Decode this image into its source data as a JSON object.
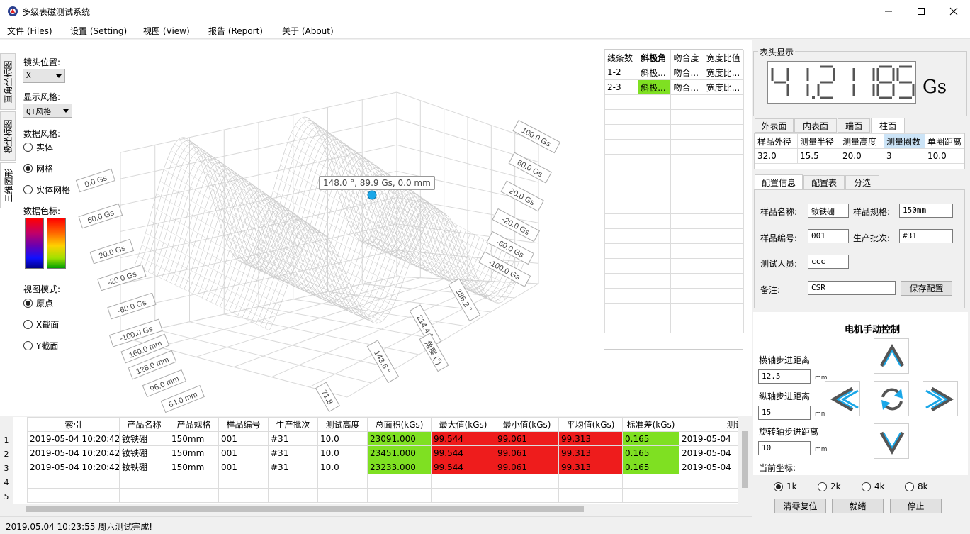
{
  "window": {
    "title": "多级表磁测试系统"
  },
  "menu": [
    {
      "label": "文件 (Files)"
    },
    {
      "label": "设置 (Setting)"
    },
    {
      "label": "视图 (View)"
    },
    {
      "label": "报告 (Report)"
    },
    {
      "label": "关于 (About)"
    }
  ],
  "vertical_tabs": [
    "直角坐标图",
    "极坐标图",
    "三维图形"
  ],
  "left_controls": {
    "lens_position_label": "镜头位置:",
    "lens_position_value": "X",
    "display_style_label": "显示风格:",
    "display_style_value": "QT风格",
    "data_style_label": "数据风格:",
    "data_style_options": [
      "实体",
      "网格",
      "实体网格"
    ],
    "data_style_selected": "网格",
    "colormap_label": "数据色标:",
    "view_mode_label": "视图模式:",
    "view_mode_options": [
      "原点",
      "X截面",
      "Y截面"
    ],
    "view_mode_selected": "原点"
  },
  "plot3d": {
    "tooltip": "148.0 °, 89.9 Gs, 0.0 mm",
    "left_z_labels": [
      "0.0 Gs",
      "60.0 Gs",
      "20.0 Gs",
      "-20.0 Gs",
      "-60.0 Gs",
      "-100.0 Gs"
    ],
    "right_z_labels": [
      "100.0 Gs",
      "60.0 Gs",
      "20.0 Gs",
      "-20.0 Gs",
      "-60.0 Gs",
      "-100.0 Gs"
    ],
    "depth_labels": [
      "160.0 mm",
      "128.0 mm",
      "96.0 mm",
      "64.0 mm"
    ],
    "angle_labels": [
      "286.2 °",
      "214.4 °",
      "143.6 °",
      "71.8"
    ],
    "angle_axis_title": "角度 (°)",
    "colors": {
      "mesh": "#c8c8c8",
      "grid": "#d9d9d9",
      "point": "#1aa7e8"
    }
  },
  "side_table": {
    "headers": [
      "线条数",
      "斜极角",
      "吻合度",
      "宽度比值"
    ],
    "rows": [
      [
        "1-2",
        "斜极...",
        "吻合...",
        "宽度比..."
      ],
      [
        "2-3",
        "斜极...",
        "吻合...",
        "宽度比..."
      ]
    ],
    "highlight_color": "#7fe022"
  },
  "results_table": {
    "headers": [
      "索引",
      "产品名称",
      "产品规格",
      "样品编号",
      "生产批次",
      "测试高度",
      "总面积(kGs)",
      "最大值(kGs)",
      "最小值(kGs)",
      "平均值(kGs)",
      "标准差(kGs)",
      "测试日"
    ],
    "row_numbers": [
      "1",
      "2",
      "3",
      "4",
      "5"
    ],
    "rows": [
      [
        "2019-05-04 10:20:42",
        "钕铁硼",
        "150mm",
        "001",
        "#31",
        "10.0",
        "23091.000",
        "99.544",
        "99.061",
        "99.313",
        "0.165",
        "2019-05-04"
      ],
      [
        "2019-05-04 10:20:42",
        "钕铁硼",
        "150mm",
        "001",
        "#31",
        "10.0",
        "23451.000",
        "99.544",
        "99.061",
        "99.313",
        "0.165",
        "2019-05-04"
      ],
      [
        "2019-05-04 10:20:42",
        "钕铁硼",
        "150mm",
        "001",
        "#31",
        "10.0",
        "23233.000",
        "99.544",
        "99.061",
        "99.313",
        "0.165",
        "2019-05-04"
      ]
    ]
  },
  "status": "2019.05.04 10:23:55 周六测试完成!",
  "meter": {
    "group_title": "表头显示",
    "value": "41.21185",
    "unit": "Gs"
  },
  "surface_tabs": {
    "labels": [
      "外表面",
      "内表面",
      "端面",
      "柱面"
    ],
    "active": "柱面",
    "headers": [
      "样品外径",
      "测量半径",
      "测量高度",
      "测量圈数",
      "单圈距离"
    ],
    "values": [
      "32.0",
      "15.5",
      "20.0",
      "3",
      "10.0"
    ]
  },
  "config_tabs": {
    "labels": [
      "配置信息",
      "配置表",
      "分选"
    ],
    "active": "配置信息",
    "sample_name_label": "样品名称:",
    "sample_name": "钕铁硼",
    "sample_spec_label": "样品规格:",
    "sample_spec": "150mm",
    "sample_no_label": "样品编号:",
    "sample_no": "001",
    "batch_label": "生产批次:",
    "batch": "#31",
    "tester_label": "测试人员:",
    "tester": "ccc",
    "remark_label": "备注:",
    "remark": "CSR",
    "save_button": "保存配置"
  },
  "motor": {
    "title": "电机手动控制",
    "h_step_label": "横轴步进距离",
    "h_step": "12.5",
    "v_step_label": "纵轴步进距离",
    "v_step": "15",
    "r_step_label": "旋转轴步进距离",
    "r_step": "10",
    "unit": "mm",
    "coord_label": "当前坐标:",
    "speed_options": [
      "1k",
      "2k",
      "4k",
      "8k"
    ],
    "speed_selected": "1k",
    "reset_button": "清零复位",
    "ready_button": "就绪",
    "stop_button": "停止",
    "arrow_color": "#1aa7e8"
  }
}
